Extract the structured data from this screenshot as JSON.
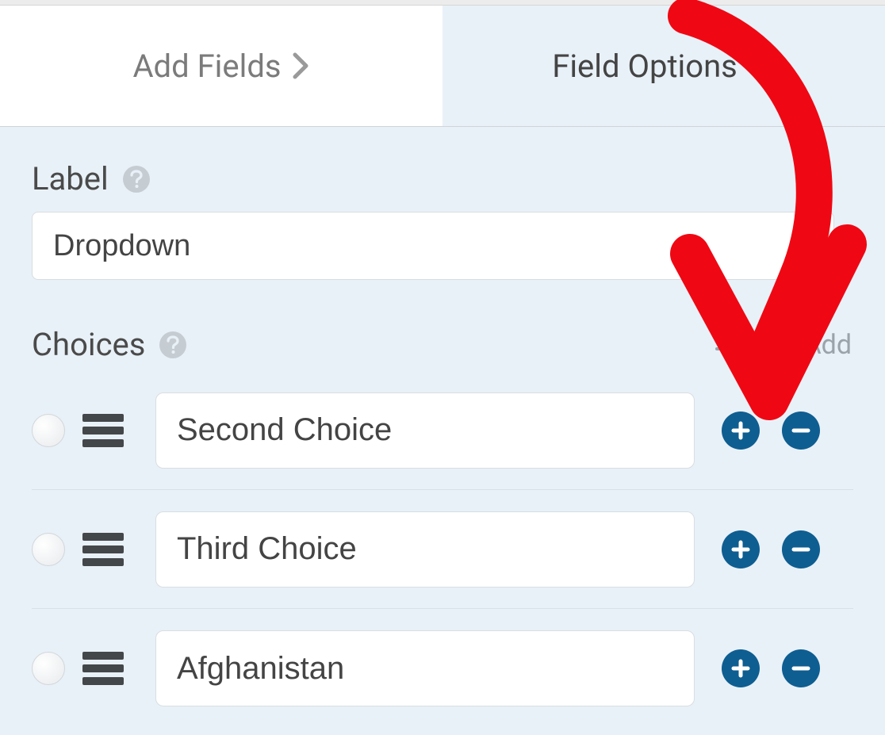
{
  "tabs": {
    "add_fields": "Add Fields",
    "field_options": "Field Options"
  },
  "label_section": {
    "title": "Label",
    "value": "Dropdown"
  },
  "choices_section": {
    "title": "Choices",
    "bulk_add": "Bulk Add"
  },
  "choices": [
    {
      "value": "Second Choice"
    },
    {
      "value": "Third Choice"
    },
    {
      "value": "Afghanistan"
    }
  ],
  "colors": {
    "accent": "#0e5e91",
    "annotation": "#ef0813"
  }
}
